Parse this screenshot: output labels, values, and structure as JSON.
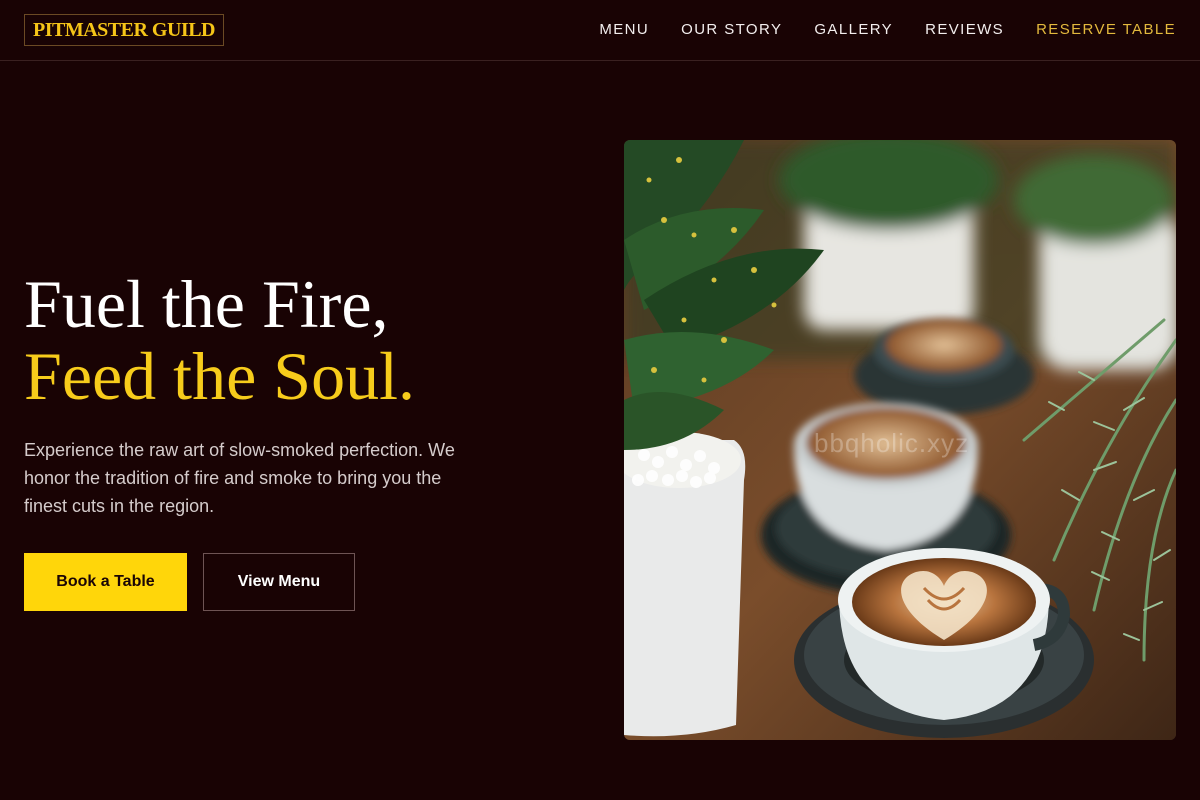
{
  "brand": {
    "logo_text": "PITMASTER GUILD"
  },
  "nav": {
    "items": [
      {
        "label": "MENU"
      },
      {
        "label": "OUR STORY"
      },
      {
        "label": "GALLERY"
      },
      {
        "label": "REVIEWS"
      },
      {
        "label": "RESERVE TABLE"
      }
    ]
  },
  "hero": {
    "headline_line1": "Fuel the Fire,",
    "headline_line2": "Feed the Soul.",
    "description": "Experience the raw art of slow-smoked perfection. We honor the tradition of fire and smoke to bring you the finest cuts in the region.",
    "primary_button": "Book a Table",
    "secondary_button": "View Menu",
    "image_watermark": "bbqholic.xyz"
  },
  "colors": {
    "background": "#190304",
    "accent_yellow": "#ffd60a",
    "headline_accent": "#f7cc1b",
    "nav_accent": "#e3b93d"
  }
}
